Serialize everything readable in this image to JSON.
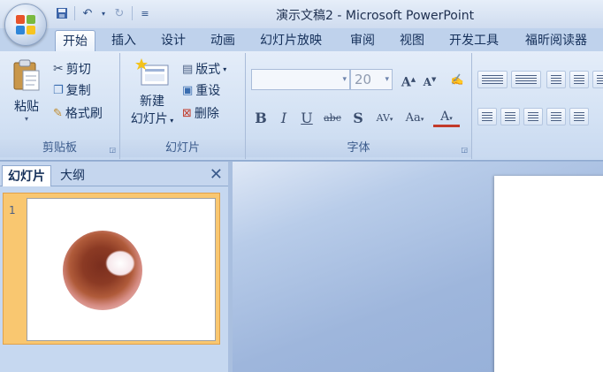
{
  "window": {
    "title": "演示文稿2 - Microsoft PowerPoint"
  },
  "quick_access": {
    "save_icon": "save-icon",
    "undo_icon": "undo-icon",
    "redo_icon": "redo-icon",
    "customize_icon": "customize-icon"
  },
  "tabs": [
    {
      "label": "开始",
      "active": true
    },
    {
      "label": "插入"
    },
    {
      "label": "设计"
    },
    {
      "label": "动画"
    },
    {
      "label": "幻灯片放映"
    },
    {
      "label": "审阅"
    },
    {
      "label": "视图"
    },
    {
      "label": "开发工具"
    },
    {
      "label": "福昕阅读器"
    }
  ],
  "ribbon": {
    "clipboard": {
      "label": "剪贴板",
      "paste": "粘贴",
      "cut": "剪切",
      "copy": "复制",
      "format_painter": "格式刷"
    },
    "slides": {
      "label": "幻灯片",
      "new_slide_line1": "新建",
      "new_slide_line2": "幻灯片",
      "layout": "版式",
      "reset": "重设",
      "delete": "删除"
    },
    "font": {
      "label": "字体",
      "font_name": "",
      "font_size": "20"
    }
  },
  "pane": {
    "tab_slides": "幻灯片",
    "tab_outline": "大纲",
    "slide_number": "1"
  },
  "colors": {
    "ribbon_bg": "#d4e2f4",
    "selection": "#f9c770",
    "accent": "#15305a"
  }
}
